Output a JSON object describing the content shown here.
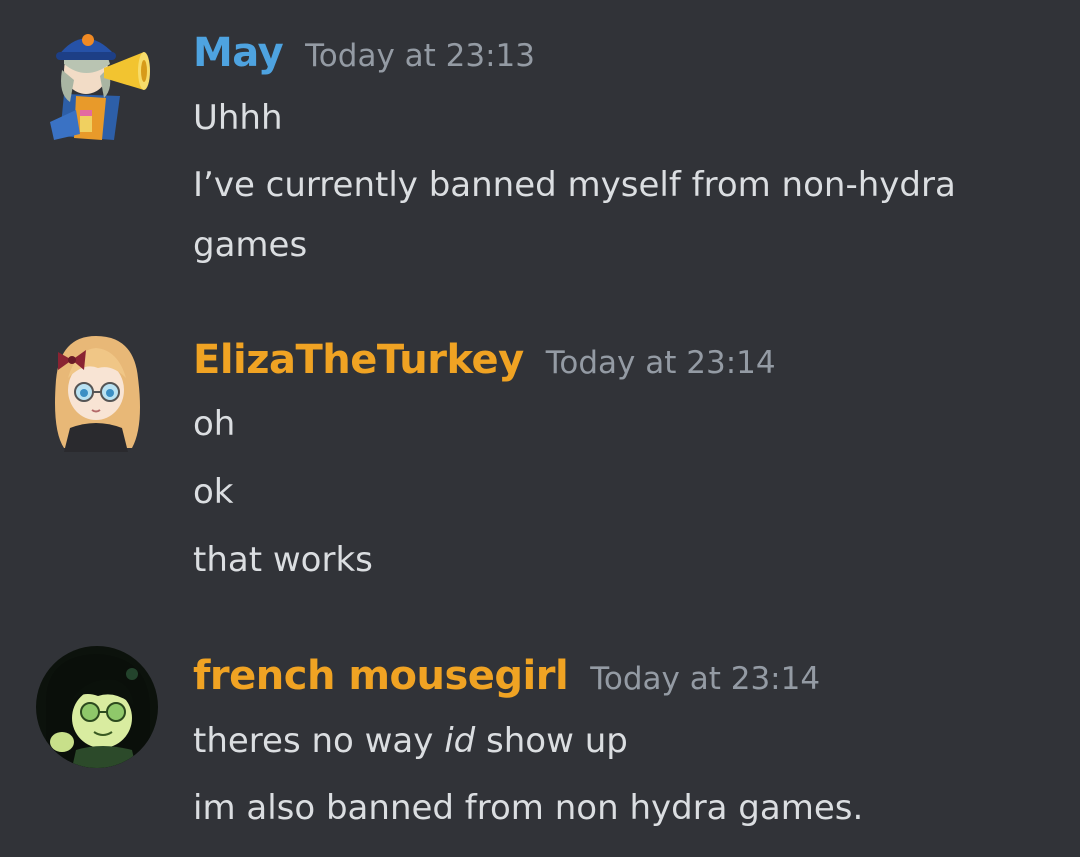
{
  "messages": [
    {
      "username": "May",
      "username_color": "#4ea3e0",
      "timestamp": "Today at 23:13",
      "avatar": "anime-character-with-megaphone-avatar",
      "lines": [
        "Uhhh",
        "I’ve currently banned myself from non-hydra games"
      ]
    },
    {
      "username": "ElizaTheTurkey",
      "username_color": "#f0a323",
      "timestamp": "Today at 23:14",
      "avatar": "anime-girl-with-glasses-avatar",
      "lines": [
        "oh",
        "ok",
        "that works"
      ]
    },
    {
      "username": "french mousegirl",
      "username_color": "#f0a323",
      "timestamp": "Today at 23:14",
      "avatar": "green-tinted-character-avatar",
      "lines": [
        {
          "before": "theres no way ",
          "italic": "id",
          "after": " show up"
        },
        "im also banned from non hydra games."
      ]
    }
  ]
}
